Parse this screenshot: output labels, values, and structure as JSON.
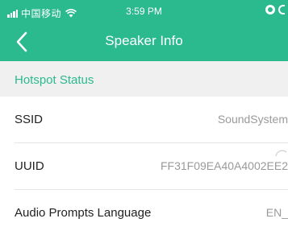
{
  "status_bar": {
    "carrier": "中国移动",
    "time": "3:59 PM"
  },
  "nav": {
    "title": "Speaker Info",
    "back_icon": "chevron-left-icon"
  },
  "section": {
    "title": "Hotspot Status"
  },
  "rows": [
    {
      "label": "SSID",
      "value": "SoundSystem"
    },
    {
      "label": "UUID",
      "value": "FF31F09EA40A4002EE2"
    },
    {
      "label": "Audio Prompts Language",
      "value": "EN_"
    }
  ],
  "colors": {
    "accent": "#2bb98e",
    "section_bg": "#f0f0f0",
    "value_text": "#9a9a9a"
  }
}
